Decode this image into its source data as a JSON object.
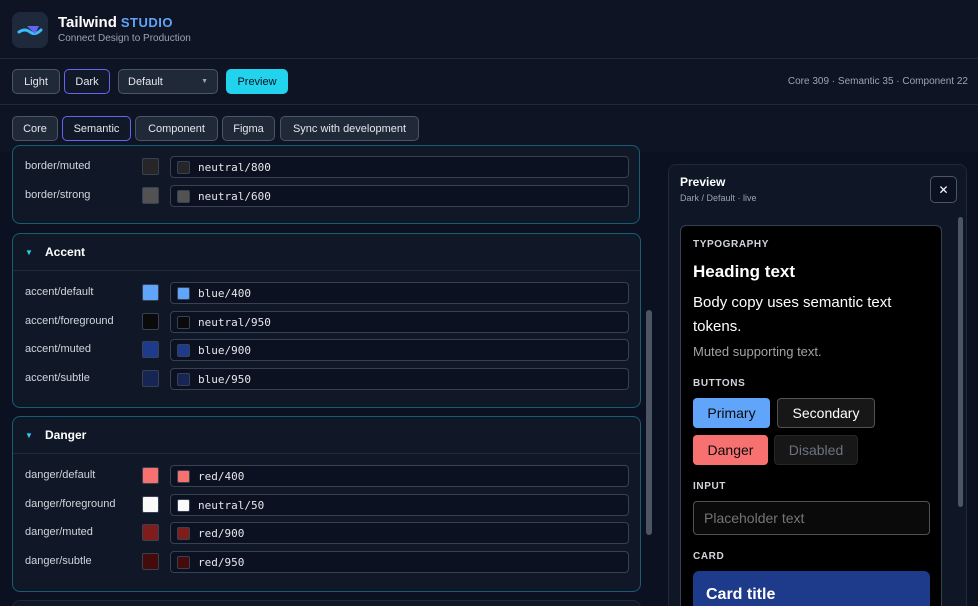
{
  "app": {
    "name": "Tailwind",
    "name_suffix": "STUDIO",
    "tagline": "Connect Design to Production"
  },
  "toolbar": {
    "light_label": "Light",
    "dark_label": "Dark",
    "theme_select": "Default",
    "preview_label": "Preview",
    "counts": "Core 309 · Semantic 35 · Component 22"
  },
  "tabs": [
    "Core",
    "Semantic",
    "Component",
    "Figma",
    "Sync with development"
  ],
  "active_tab": "Semantic",
  "border_rows": [
    {
      "name": "border/muted",
      "value": "neutral/800",
      "color": "#262626"
    },
    {
      "name": "border/strong",
      "value": "neutral/600",
      "color": "#525252"
    }
  ],
  "groups": [
    {
      "title": "Accent",
      "rows": [
        {
          "name": "accent/default",
          "value": "blue/400",
          "color": "#60a5fa"
        },
        {
          "name": "accent/foreground",
          "value": "neutral/950",
          "color": "#0a0a0a"
        },
        {
          "name": "accent/muted",
          "value": "blue/900",
          "color": "#1e3a8a"
        },
        {
          "name": "accent/subtle",
          "value": "blue/950",
          "color": "#172554"
        }
      ]
    },
    {
      "title": "Danger",
      "rows": [
        {
          "name": "danger/default",
          "value": "red/400",
          "color": "#f87171"
        },
        {
          "name": "danger/foreground",
          "value": "neutral/50",
          "color": "#fafafa"
        },
        {
          "name": "danger/muted",
          "value": "red/900",
          "color": "#7f1d1d"
        },
        {
          "name": "danger/subtle",
          "value": "red/950",
          "color": "#450a0a"
        }
      ]
    }
  ],
  "preview": {
    "title": "Preview",
    "subtitle": "Dark / Default · live",
    "close_icon": "close-icon",
    "typography_label": "TYPOGRAPHY",
    "heading": "Heading text",
    "body": "Body copy uses semantic text tokens.",
    "muted": "Muted supporting text.",
    "buttons_label": "BUTTONS",
    "btn_primary": "Primary",
    "btn_secondary": "Secondary",
    "btn_danger": "Danger",
    "btn_disabled": "Disabled",
    "input_label": "INPUT",
    "input_placeholder": "Placeholder text",
    "card_label": "CARD",
    "card_title": "Card title"
  },
  "colors": {
    "accent": "#22d3ee",
    "primary": "#60a5fa",
    "danger": "#f87171",
    "card_bg": "#1e3a8a"
  }
}
